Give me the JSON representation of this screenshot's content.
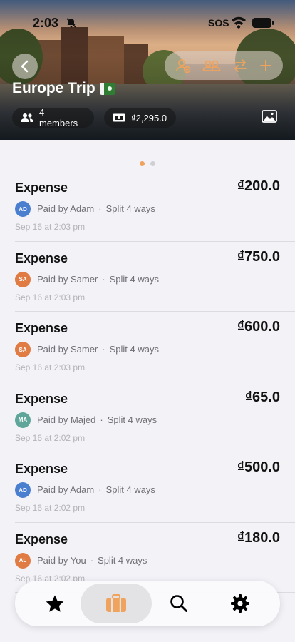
{
  "status_bar": {
    "time": "2:03",
    "sos": "SOS"
  },
  "trip": {
    "title": "Europe Trip",
    "members_label": "4 members",
    "total_label": "₫2,295.0"
  },
  "pager": {
    "count": 2,
    "active_index": 0
  },
  "expenses": [
    {
      "title": "Expense",
      "amount": "₫200.0",
      "avatar": "AD",
      "avatar_color": "#4a7fd0",
      "paid_by": "Paid by Adam",
      "split": "Split 4 ways",
      "date": "Sep 16 at 2:03 pm"
    },
    {
      "title": "Expense",
      "amount": "₫750.0",
      "avatar": "SA",
      "avatar_color": "#e07b43",
      "paid_by": "Paid by Samer",
      "split": "Split 4 ways",
      "date": "Sep 16 at 2:03 pm"
    },
    {
      "title": "Expense",
      "amount": "₫600.0",
      "avatar": "SA",
      "avatar_color": "#e07b43",
      "paid_by": "Paid by Samer",
      "split": "Split 4 ways",
      "date": "Sep 16 at 2:03 pm"
    },
    {
      "title": "Expense",
      "amount": "₫65.0",
      "avatar": "MA",
      "avatar_color": "#5fa59a",
      "paid_by": "Paid by Majed",
      "split": "Split 4 ways",
      "date": "Sep 16 at 2:02 pm"
    },
    {
      "title": "Expense",
      "amount": "₫500.0",
      "avatar": "AD",
      "avatar_color": "#4a7fd0",
      "paid_by": "Paid by Adam",
      "split": "Split 4 ways",
      "date": "Sep 16 at 2:02 pm"
    },
    {
      "title": "Expense",
      "amount": "₫180.0",
      "avatar": "AL",
      "avatar_color": "#e07b43",
      "paid_by": "Paid by You",
      "split": "Split 4 ways",
      "date": "Sep 16 at 2:02 pm"
    }
  ],
  "tabs": [
    {
      "icon": "star-icon",
      "selected": false
    },
    {
      "icon": "briefcase-icon",
      "selected": true
    },
    {
      "icon": "search-icon",
      "selected": false
    },
    {
      "icon": "gear-icon",
      "selected": false
    }
  ],
  "colors": {
    "accent": "#f0a35c",
    "background": "#f2f2f7"
  }
}
